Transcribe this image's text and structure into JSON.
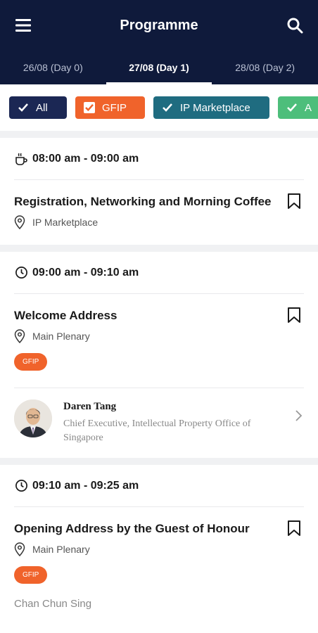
{
  "header": {
    "title": "Programme",
    "tabs": [
      {
        "label": "26/08 (Day 0)"
      },
      {
        "label": "27/08 (Day 1)"
      },
      {
        "label": "28/08 (Day 2)"
      }
    ]
  },
  "filters": [
    {
      "label": "All"
    },
    {
      "label": "GFIP"
    },
    {
      "label": "IP Marketplace"
    },
    {
      "label": "A"
    }
  ],
  "sessions": [
    {
      "time": "08:00 am - 09:00 am",
      "icon": "coffee-icon",
      "title": "Registration, Networking and Morning Coffee",
      "location": "IP Marketplace"
    },
    {
      "time": "09:00 am - 09:10 am",
      "icon": "clock-icon",
      "title": "Welcome Address",
      "location": "Main Plenary",
      "tag": "GFIP",
      "speaker": {
        "name": "Daren Tang",
        "role": "Chief Executive, Intellectual Property Office of Singapore"
      }
    },
    {
      "time": "09:10 am - 09:25 am",
      "icon": "clock-icon",
      "title": "Opening Address by the Guest of Honour",
      "location": "Main Plenary",
      "tag": "GFIP",
      "speaker_name": "Chan Chun Sing"
    }
  ],
  "colors": {
    "header_bg": "#0f1a3b",
    "gfip": "#f0632b",
    "ip_marketplace": "#1f6c80",
    "all": "#1b2754",
    "green": "#4dbe7b"
  }
}
